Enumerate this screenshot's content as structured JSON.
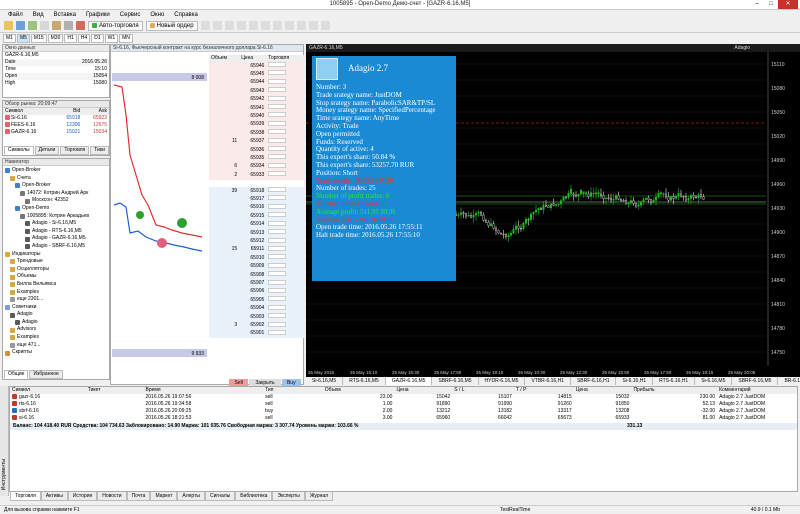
{
  "window": {
    "title": "1005895 - Open-Demo Демо-счет - [GAZR-6.16,M5]"
  },
  "menu": [
    "Файл",
    "Вид",
    "Вставка",
    "Графики",
    "Сервис",
    "Окно",
    "Справка"
  ],
  "toolbar": {
    "autotrade_label": "Авто-торговля",
    "new_order_label": "Новый ордер"
  },
  "timeframes": [
    "M1",
    "M5",
    "M15",
    "M30",
    "H1",
    "H4",
    "D1",
    "W1",
    "MN"
  ],
  "data_window": {
    "title": "Окно данных",
    "symbol": "GAZR-6.16,M5",
    "rows": [
      {
        "k": "Date",
        "v": "2016.05.26"
      },
      {
        "k": "Time",
        "v": "15:10"
      },
      {
        "k": "Open",
        "v": "15054"
      },
      {
        "k": "High",
        "v": "15080"
      }
    ]
  },
  "market_watch": {
    "title": "Обзор рынка: 20:09:47",
    "headers": [
      "Символ",
      "Bid",
      "Ask"
    ],
    "rows": [
      {
        "s": "Si-6.16",
        "b": "65918",
        "a": "65923"
      },
      {
        "s": "FEES-6.16",
        "b": "12306",
        "a": "12675"
      },
      {
        "s": "GAZR-6.16",
        "b": "15021",
        "a": "15034"
      }
    ],
    "tabs": [
      "Символы",
      "Детали",
      "Торговля",
      "Тики"
    ]
  },
  "navigator": {
    "title": "Навигатор",
    "items": [
      "Open-Broker",
      "Счета",
      "Open-Broker",
      "14072: Котрин Андрей Арк",
      "Москсон: 42352",
      "Open-Demo",
      "1005895: Котрин Аркадьев",
      "Adagio - Si-6.16,M5",
      "Adagio - RTS-6.16,M5",
      "Adagio - GAZR-6.16,M5",
      "Adagio - SBRF-6.16,M5",
      "Индикаторы",
      "Трендовые",
      "Осцилляторы",
      "Объемы",
      "Билла Вильямса",
      "Examples",
      "еще 2301...",
      "Советники",
      "Adagio",
      "Adagio",
      "Advisors",
      "Examples",
      "еще 471...",
      "Скрипты"
    ],
    "tabs": [
      "Общие",
      "Избранное"
    ]
  },
  "dom": {
    "title": "Si-6.16, Фьючерсный контракт на курс безналичного доллара Si-6.16",
    "headers": [
      "Объем",
      "Цена",
      "Торговля"
    ],
    "rows": [
      {
        "vol": "",
        "price": "65946"
      },
      {
        "vol": "",
        "price": "65945"
      },
      {
        "vol": "",
        "price": "65944"
      },
      {
        "vol": "",
        "price": "65943"
      },
      {
        "vol": "",
        "price": "65942"
      },
      {
        "vol": "",
        "price": "65941"
      },
      {
        "vol": "",
        "price": "65940"
      },
      {
        "vol": "",
        "price": "65939"
      },
      {
        "vol": "",
        "price": "65938"
      },
      {
        "vol": "11",
        "price": "65937"
      },
      {
        "vol": "",
        "price": "65936"
      },
      {
        "vol": "",
        "price": "65935"
      },
      {
        "vol": "6",
        "price": "65934"
      },
      {
        "vol": "2",
        "price": "65933"
      },
      {
        "vol": "",
        "price": ""
      },
      {
        "vol": "39",
        "price": "65918"
      },
      {
        "vol": "",
        "price": "65917"
      },
      {
        "vol": "",
        "price": "65916"
      },
      {
        "vol": "",
        "price": "65915"
      },
      {
        "vol": "",
        "price": "65914"
      },
      {
        "vol": "",
        "price": "65913"
      },
      {
        "vol": "",
        "price": "65912"
      },
      {
        "vol": "15",
        "price": "65911"
      },
      {
        "vol": "",
        "price": "65910"
      },
      {
        "vol": "",
        "price": "65909"
      },
      {
        "vol": "",
        "price": "65908"
      },
      {
        "vol": "",
        "price": "65907"
      },
      {
        "vol": "",
        "price": "65906"
      },
      {
        "vol": "",
        "price": "65905"
      },
      {
        "vol": "",
        "price": "65904"
      },
      {
        "vol": "",
        "price": "65903"
      },
      {
        "vol": "3",
        "price": "65902"
      },
      {
        "vol": "",
        "price": "65901"
      }
    ],
    "top_value": "8 008",
    "bottom_value": "9 933",
    "sell": "Sell",
    "close": "Закрыть",
    "buy": "Buy"
  },
  "chart": {
    "header": "GAZR-6.16,M5",
    "expert_label": "Adagio",
    "price_ticks": [
      "15110",
      "15080",
      "15050",
      "15020",
      "14990",
      "14960",
      "14930",
      "14900",
      "14870",
      "14840",
      "14810",
      "14780",
      "14750"
    ],
    "time_ticks": [
      "25 May 2016",
      "25 May 15:10",
      "25 May 16:30",
      "25 May 17:50",
      "25 May 19:10",
      "26 May 10:30",
      "26 May 12:30",
      "26 May 15:50",
      "26 May 17:50",
      "26 May 19:15",
      "26 May 20:05"
    ],
    "tabs": [
      "Si-6.16,M5",
      "RTS-6.16,M5",
      "GAZR-6.16,M5",
      "SBRF-6.16,M5",
      "HYDR-6.16,M5",
      "VTBR-6.16,H1",
      "SBRF-6.16,H1",
      "Si-6.16,H1",
      "RTS-6.16,H1",
      "Si-6.16,M5",
      "SBRF-6.16,M5",
      "BR-6.16,M5"
    ]
  },
  "infobox": {
    "title": "Adagio 2.7",
    "lines": [
      {
        "t": "Number: 3",
        "c": ""
      },
      {
        "t": "Trade srategy name: JustDOM",
        "c": ""
      },
      {
        "t": "Stop srategy name: ParabolicSAR&TP/SL",
        "c": ""
      },
      {
        "t": "Money srategy name: SpecifiedPercentage",
        "c": ""
      },
      {
        "t": "Time srategy name: AnyTime",
        "c": ""
      },
      {
        "t": "Activity: Trade",
        "c": ""
      },
      {
        "t": "Open permitted",
        "c": ""
      },
      {
        "t": "Funds: Reserved",
        "c": ""
      },
      {
        "t": "Quantity of active: 4",
        "c": ""
      },
      {
        "t": "This expert's share: 50.84 %",
        "c": ""
      },
      {
        "t": "This expert's share: 53257.70  RUR",
        "c": ""
      },
      {
        "t": "Position: Short",
        "c": ""
      },
      {
        "t": "Trade result: -3003.89 RUR",
        "c": "red"
      },
      {
        "t": "Number of trades: 25",
        "c": ""
      },
      {
        "t": "Number of profit trades: 6",
        "c": "grn"
      },
      {
        "t": "Number of loss trades: 19",
        "c": "red"
      },
      {
        "t": "Average profit: 511.95  RUR",
        "c": "grn"
      },
      {
        "t": "Average loss: -286.26  RUR",
        "c": "red"
      },
      {
        "t": "Open trade time: 2016.05.26 17:55:11",
        "c": ""
      },
      {
        "t": "Halt trade time: 2016.05.26 17:55:10",
        "c": ""
      }
    ]
  },
  "terminal": {
    "headers": [
      "Символ",
      "Тикет",
      "Время",
      "Тип",
      "Объем",
      "Цена",
      "S / L",
      "T / P",
      "Цена",
      "Прибыль",
      "Комментарий"
    ],
    "rows": [
      {
        "c": [
          "gazr-6.16",
          "",
          "2016.05.26 19:07:56",
          "sell",
          "23.00",
          "15042",
          "15107",
          "14815",
          "15032",
          "230.00",
          "Adagio 2.7 JustDOM"
        ],
        "col": "#c0392b"
      },
      {
        "c": [
          "rts-6.16",
          "",
          "2016.05.26 19:34:58",
          "sell",
          "1.00",
          "91890",
          "91990",
          "91260",
          "91850",
          "52.13",
          "Adagio 2.7 JustDOM"
        ],
        "col": "#c0392b"
      },
      {
        "c": [
          "sbrf-6.16",
          "",
          "2016.05.26 20:09:25",
          "buy",
          "2.00",
          "13212",
          "13182",
          "13317",
          "13208",
          "-32.00",
          "Adagio 2.7 JustDOM"
        ],
        "col": "#2b6cc0"
      },
      {
        "c": [
          "si-6.16",
          "",
          "2016.05.26 18:21:53",
          "sell",
          "3.00",
          "65960",
          "66042",
          "65673",
          "65933",
          "81.00",
          "Adagio 2.7 JustDOM"
        ],
        "col": "#c0392b"
      }
    ],
    "balance_line": "Баланс: 104 418.40 RUR  Средства: 104 734.63  Заблокировано: 14.90  Маржа: 101 035.76  Свободная маржа: 3 307.74  Уровень маржи: 103.66 %",
    "total": "331.13",
    "tabs": [
      "Торговля",
      "Активы",
      "История",
      "Новости",
      "Почта",
      "Маркет",
      "Алерты",
      "Сигналы",
      "Библиотека",
      "Эксперты",
      "Журнал"
    ],
    "side_label": "Инструменты"
  },
  "status": {
    "help": "Для вызова справки нажмите F1",
    "server": "TestRealTime",
    "traffic": "40.9 / 0.1 Mb"
  }
}
